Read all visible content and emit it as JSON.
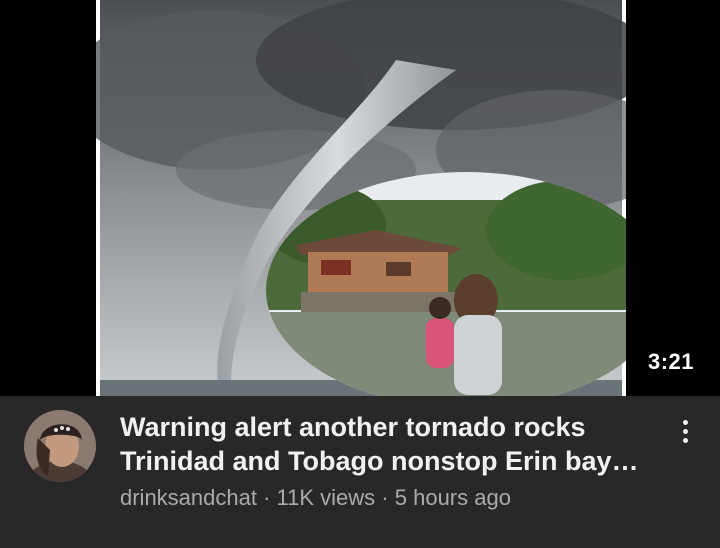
{
  "video": {
    "duration": "3:21",
    "title": "Warning alert another tornado rocks Trinidad and Tobago nonstop Erin bay #…",
    "channel": "drinksandchat",
    "views": "11K views",
    "age": "5 hours ago",
    "separator": " · "
  },
  "icons": {
    "more": "more-vert-icon",
    "avatar": "channel-avatar"
  },
  "colors": {
    "background": "#282828",
    "title": "#f1f1f1",
    "meta": "#aaaaaa"
  }
}
